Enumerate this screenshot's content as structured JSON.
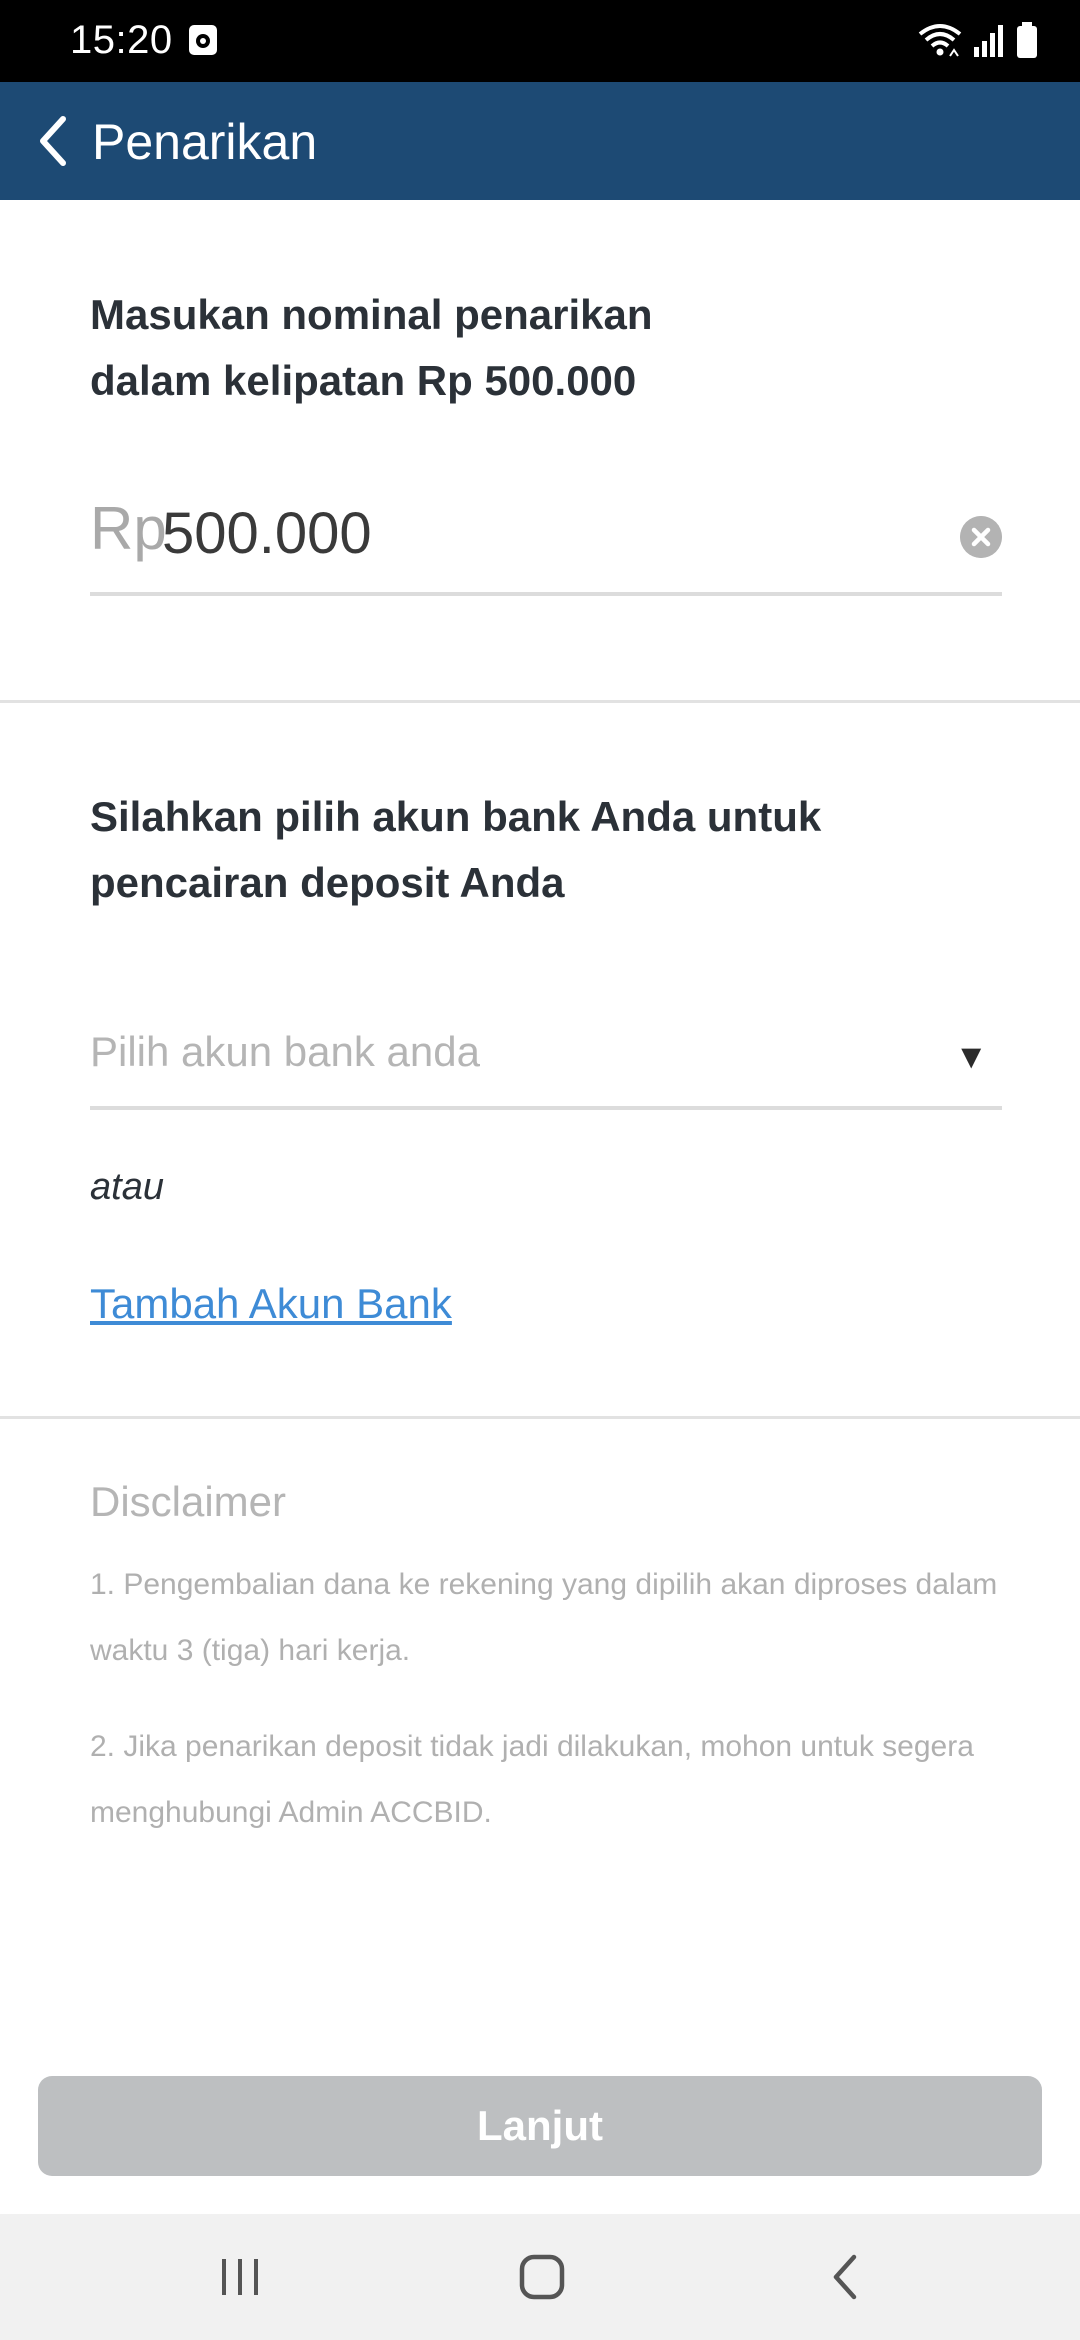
{
  "status_bar": {
    "time": "15:20",
    "icons": [
      "media-notification-icon",
      "wifi-icon",
      "signal-icon",
      "battery-icon"
    ]
  },
  "app_bar": {
    "title": "Penarikan",
    "back_icon": "back-arrow-icon",
    "background_color": "#1d4a74"
  },
  "amount_section": {
    "prompt_line1": "Masukan nominal penarikan",
    "prompt_line2": "dalam kelipatan Rp 500.000",
    "currency_prefix": "Rp",
    "value": "500.000",
    "clear_icon": "clear-icon"
  },
  "bank_section": {
    "prompt_line1": "Silahkan pilih akun bank Anda untuk",
    "prompt_line2": "pencairan deposit Anda",
    "select_placeholder": "Pilih akun bank anda",
    "dropdown_icon": "▼",
    "or_text": "atau",
    "add_bank_link": "Tambah Akun Bank",
    "link_color": "#3e8bd6"
  },
  "disclaimer": {
    "title": "Disclaimer",
    "items": [
      {
        "line1": "1. Pengembalian dana ke rekening yang dipilih akan diproses dalam",
        "line2": "waktu 3 (tiga) hari kerja."
      },
      {
        "line1": "2. Jika penarikan deposit tidak jadi dilakukan, mohon untuk segera",
        "line2": "menghubungi Admin ACCBID."
      }
    ]
  },
  "submit": {
    "label": "Lanjut",
    "state": "disabled",
    "color": "#bdbfc1"
  },
  "nav_bar": {
    "items": [
      "recent-apps-icon",
      "home-icon",
      "back-icon"
    ]
  }
}
